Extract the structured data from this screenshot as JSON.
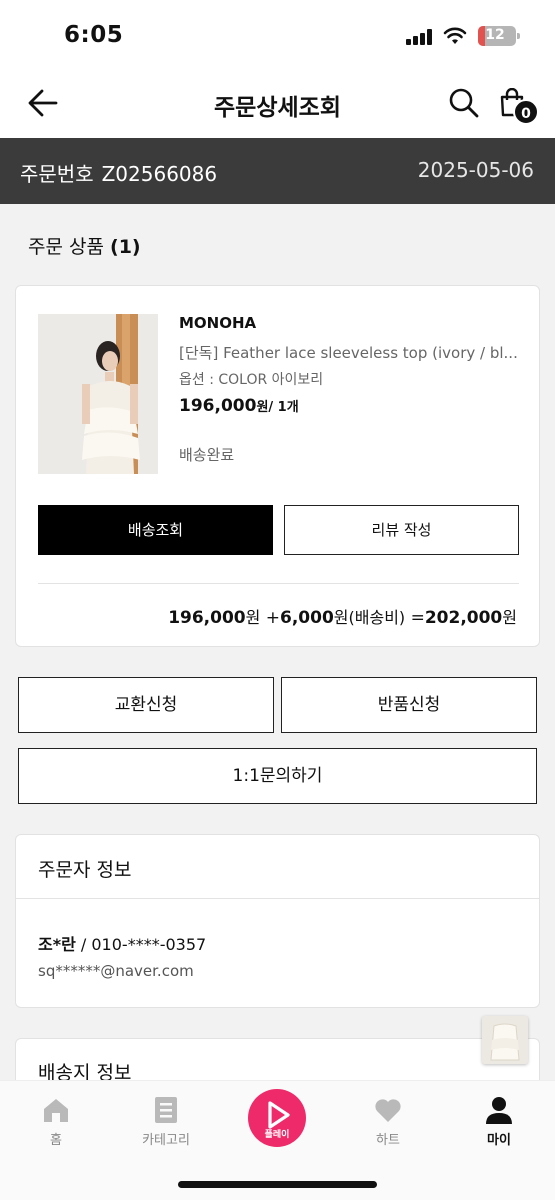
{
  "status_bar": {
    "time": "6:05",
    "battery": "12",
    "battery_level_percent": 12
  },
  "header": {
    "title": "주문상세조회",
    "cart_count": "0"
  },
  "order": {
    "number_label": "주문번호",
    "number": "Z02566086",
    "date": "2025-05-06"
  },
  "products_section": {
    "title": "주문 상품",
    "count": "(1)"
  },
  "product": {
    "brand": "MONOHA",
    "name": "[단독] Feather lace sleeveless top (ivory / bl...",
    "option": "옵션 : COLOR 아이보리",
    "price": "196,000",
    "price_unit_qty": "원/ 1개",
    "status": "배송완료",
    "track_button": "배송조회",
    "review_button": "리뷰 작성"
  },
  "price_summary": {
    "item_price": "196,000",
    "won": "원",
    "plus": "+",
    "shipping_price": "6,000",
    "shipping_label": "원(배송비)",
    "equals": "=",
    "total": "202,000",
    "total_won": "원"
  },
  "actions": {
    "exchange": "교환신청",
    "return": "반품신청",
    "inquiry": "1:1문의하기"
  },
  "orderer": {
    "title": "주문자 정보",
    "name": "조*란",
    "separator": " / ",
    "phone": "010-****-0357",
    "email": "sq******@naver.com"
  },
  "shipping": {
    "title": "배송지 정보"
  },
  "bottom_nav": {
    "home": "홈",
    "category": "카테고리",
    "play": "플레이",
    "heart": "하트",
    "my": "마이"
  },
  "colors": {
    "play_accent": "#ee2a6a",
    "order_bar": "#3b3b3b",
    "battery_low": "#e2524e"
  }
}
